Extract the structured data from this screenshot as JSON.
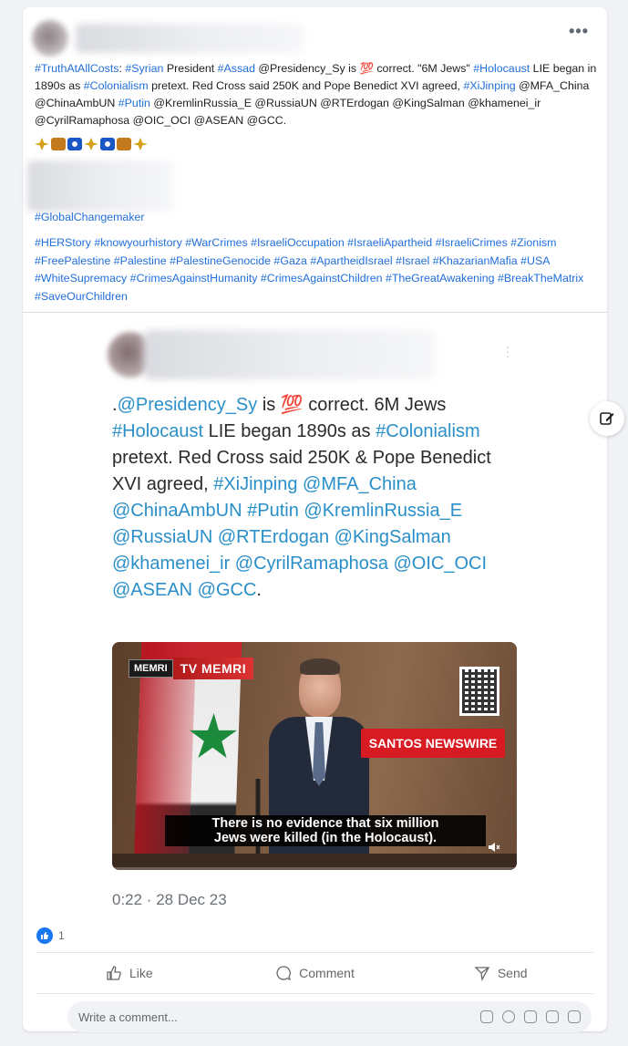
{
  "post": {
    "author_blurred": true,
    "menu_label": "•••",
    "text_segments": [
      {
        "t": "#TruthAtAllCosts",
        "tag": true
      },
      {
        "t": ": ",
        "tag": false
      },
      {
        "t": "#Syrian",
        "tag": true
      },
      {
        "t": " President ",
        "tag": false
      },
      {
        "t": "#Assad",
        "tag": true
      },
      {
        "t": " @Presidency_Sy is 💯 correct. \"6M Jews\" ",
        "tag": false
      },
      {
        "t": "#Holocaust",
        "tag": true
      },
      {
        "t": " LIE began in 1890s as ",
        "tag": false
      },
      {
        "t": "#Colonialism",
        "tag": true
      },
      {
        "t": " pretext. Red Cross said 250K and Pope Benedict XVI agreed, ",
        "tag": false
      },
      {
        "t": "#XiJinping",
        "tag": true
      },
      {
        "t": " @MFA_China @ChinaAmbUN ",
        "tag": false
      },
      {
        "t": "#Putin",
        "tag": true
      },
      {
        "t": " @KremlinRussia_E @RussiaUN @RTErdogan @KingSalman @khamenei_ir @CyrilRamaphosa @OIC_OCI @ASEAN @GCC.",
        "tag": false
      }
    ],
    "global_tag": "#GlobalChangemaker",
    "hashtags": "#HERStory #knowyourhistory #WarCrimes #IsraeliOccupation #IsraeliApartheid #IsraeliCrimes #Zionism #FreePalestine #Palestine #PalestineGenocide #Gaza #ApartheidIsrael #Israel #KhazarianMafia #USA #WhiteSupremacy #CrimesAgainstHumanity #CrimesAgainstChildren #TheGreatAwakening #BreakTheMatrix #SaveOurChildren"
  },
  "tweet": {
    "author_blurred": true,
    "text_segments": [
      {
        "t": ".",
        "tag": false
      },
      {
        "t": "@Presidency_Sy",
        "tag": true
      },
      {
        "t": " is 💯 correct. 6M Jews ",
        "tag": false
      },
      {
        "t": "#Holocaust",
        "tag": true
      },
      {
        "t": " LIE began 1890s as ",
        "tag": false
      },
      {
        "t": "#Colonialism",
        "tag": true
      },
      {
        "t": " pretext. Red Cross said 250K & Pope Benedict XVI agreed, ",
        "tag": false
      },
      {
        "t": "#XiJinping @MFA_China @ChinaAmbUN #Putin @KremlinRussia_E @RussiaUN @RTErdogan @KingSalman @khamenei_ir @CyrilRamaphosa @OIC_OCI @ASEAN @GCC",
        "tag": true
      },
      {
        "t": ".",
        "tag": false
      }
    ],
    "video": {
      "logo_text": "MEMRI",
      "logo_bar": "TV MEMRI",
      "overlay_label": "SANTOS NEWSWIRE",
      "subtitle_line1": "There is no evidence that six million",
      "subtitle_line2": "Jews were killed (in the Holocaust).",
      "progress_fraction": 0.0
    },
    "timestamp": "0:22 · 28 Dec 23"
  },
  "reactions": {
    "count": "1"
  },
  "actions": {
    "like": "Like",
    "comment": "Comment",
    "send": "Send"
  },
  "comment": {
    "placeholder": "Write a comment..."
  },
  "colors": {
    "hashtag": "#216fdb",
    "tweet_tag": "#2a8fc9",
    "like_blue": "#1877f2",
    "newswire_red": "#d81b23"
  }
}
